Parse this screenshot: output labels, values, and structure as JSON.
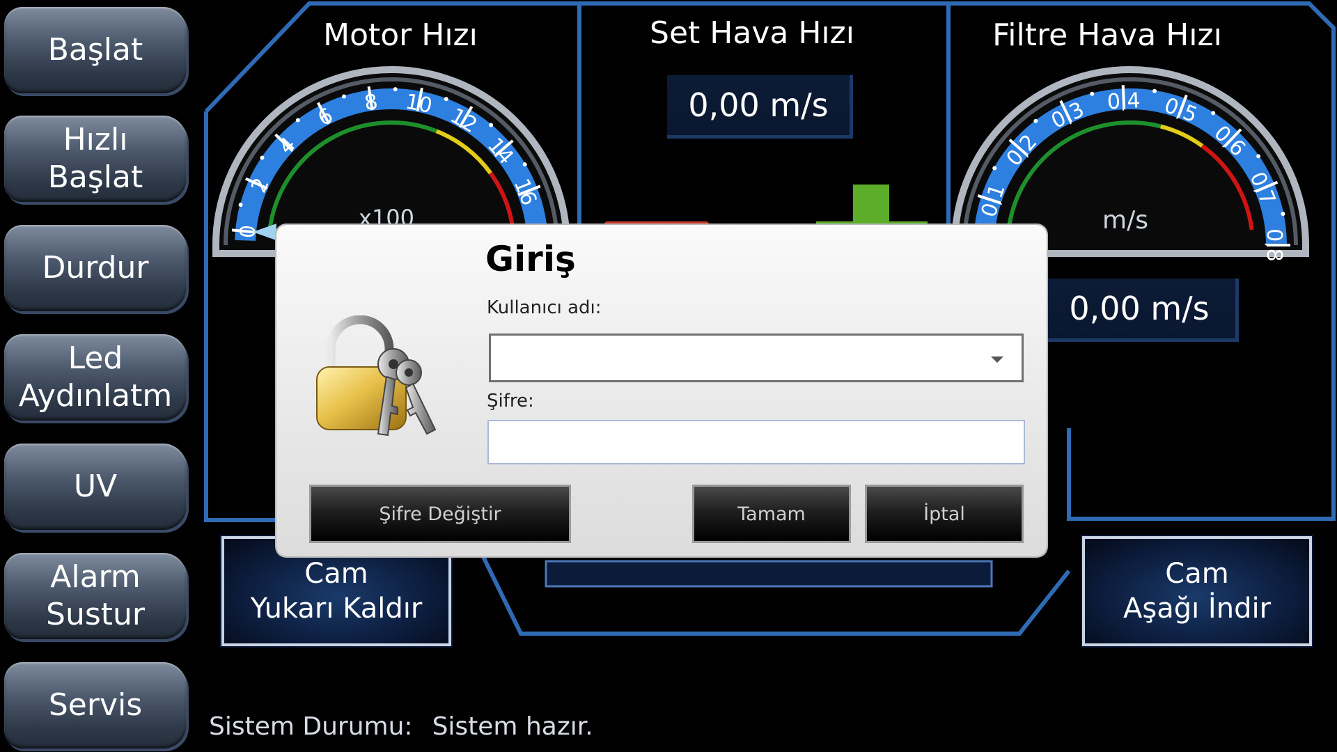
{
  "sidebar": {
    "items": [
      {
        "label": "Başlat"
      },
      {
        "label": "Hızlı\nBaşlat"
      },
      {
        "label": "Durdur"
      },
      {
        "label": "Led\nAydınlatm"
      },
      {
        "label": "UV"
      },
      {
        "label": "Alarm\nSustur"
      },
      {
        "label": "Servis"
      }
    ]
  },
  "panels": {
    "motor": {
      "title": "Motor Hızı",
      "unit": "x100",
      "ticks": [
        "0",
        "2",
        "4",
        "6",
        "8",
        "10",
        "12",
        "14",
        "16"
      ],
      "value_fraction": 0.0
    },
    "set": {
      "title": "Set Hava Hızı",
      "readout": "0,00 m/s"
    },
    "filter": {
      "title": "Filtre Hava Hızı",
      "unit": "m/s",
      "ticks": [
        "0,1",
        "0,2",
        "0,3",
        "0,4",
        "0,5",
        "0,6",
        "0,7",
        "0,8"
      ],
      "readout": "0,00 m/s"
    }
  },
  "cam": {
    "up": "Cam\nYukarı Kaldır",
    "down": "Cam\nAşağı İndir"
  },
  "status": {
    "label": "Sistem Durumu:",
    "value": "Sistem hazır."
  },
  "dialog": {
    "title": "Giriş",
    "username_label": "Kullanıcı adı:",
    "username_value": "",
    "password_label": "Şifre:",
    "password_value": "",
    "change_password": "Şifre Değiştir",
    "ok": "Tamam",
    "cancel": "İptal"
  },
  "colors": {
    "frame": "#2f6bb4",
    "gauge_blue": "#2d7fe0",
    "gauge_green": "#1e8f2a",
    "gauge_yellow": "#e2cc1a",
    "gauge_red": "#d01414"
  }
}
